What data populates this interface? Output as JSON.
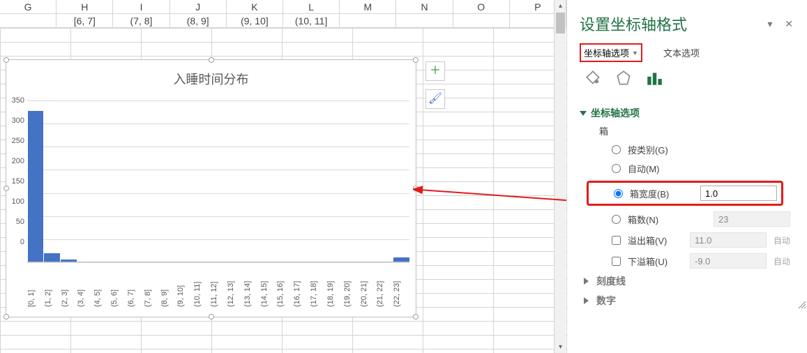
{
  "colHeaders": [
    "G",
    "H",
    "I",
    "J",
    "K",
    "L",
    "M",
    "N",
    "O",
    "P"
  ],
  "row1": [
    "",
    "[6, 7]",
    "(7, 8]",
    "(8, 9]",
    "(9, 10]",
    "(10, 11]",
    "",
    "",
    "",
    ""
  ],
  "chart": {
    "title": "入睡时间分布",
    "ymax": 350,
    "ystep": 50
  },
  "chart_data": {
    "type": "bar",
    "title": "入睡时间分布",
    "categories": [
      "[0, 1]",
      "(1, 2]",
      "(2, 3]",
      "(3, 4]",
      "(4, 5]",
      "(5, 6]",
      "(6, 7]",
      "(7, 8]",
      "(8, 9]",
      "(9, 10]",
      "(10, 11]",
      "(11, 12]",
      "(12, 13]",
      "(13, 14]",
      "(14, 15]",
      "(15, 16]",
      "(16, 17]",
      "(17, 18]",
      "(18, 19]",
      "(19, 20]",
      "(20, 21]",
      "(21, 22]",
      "(22, 23]"
    ],
    "values": [
      328,
      20,
      6,
      0,
      0,
      0,
      0,
      0,
      0,
      0,
      0,
      0,
      0,
      0,
      0,
      0,
      0,
      0,
      0,
      0,
      0,
      0,
      10
    ],
    "xlabel": "",
    "ylabel": "",
    "ylim": [
      0,
      350
    ]
  },
  "floatBtns": {
    "add": "＋",
    "brush": "🖌"
  },
  "pane": {
    "title": "设置坐标轴格式",
    "dropdown": "▾",
    "close": "✕",
    "tabAxis": "坐标轴选项",
    "tabText": "文本选项",
    "secAxisOptions": "坐标轴选项",
    "boxLabel": "箱",
    "byCategory": "按类别(G)",
    "auto": "自动(M)",
    "binWidth": "箱宽度(B)",
    "binWidthVal": "1.0",
    "binCount": "箱数(N)",
    "binCountVal": "23",
    "overflow": "溢出箱(V)",
    "overflowVal": "11.0",
    "underflow": "下溢箱(U)",
    "underflowVal": "-9.0",
    "autoLbl": "自动",
    "secTick": "刻度线",
    "secNumber": "数字"
  }
}
